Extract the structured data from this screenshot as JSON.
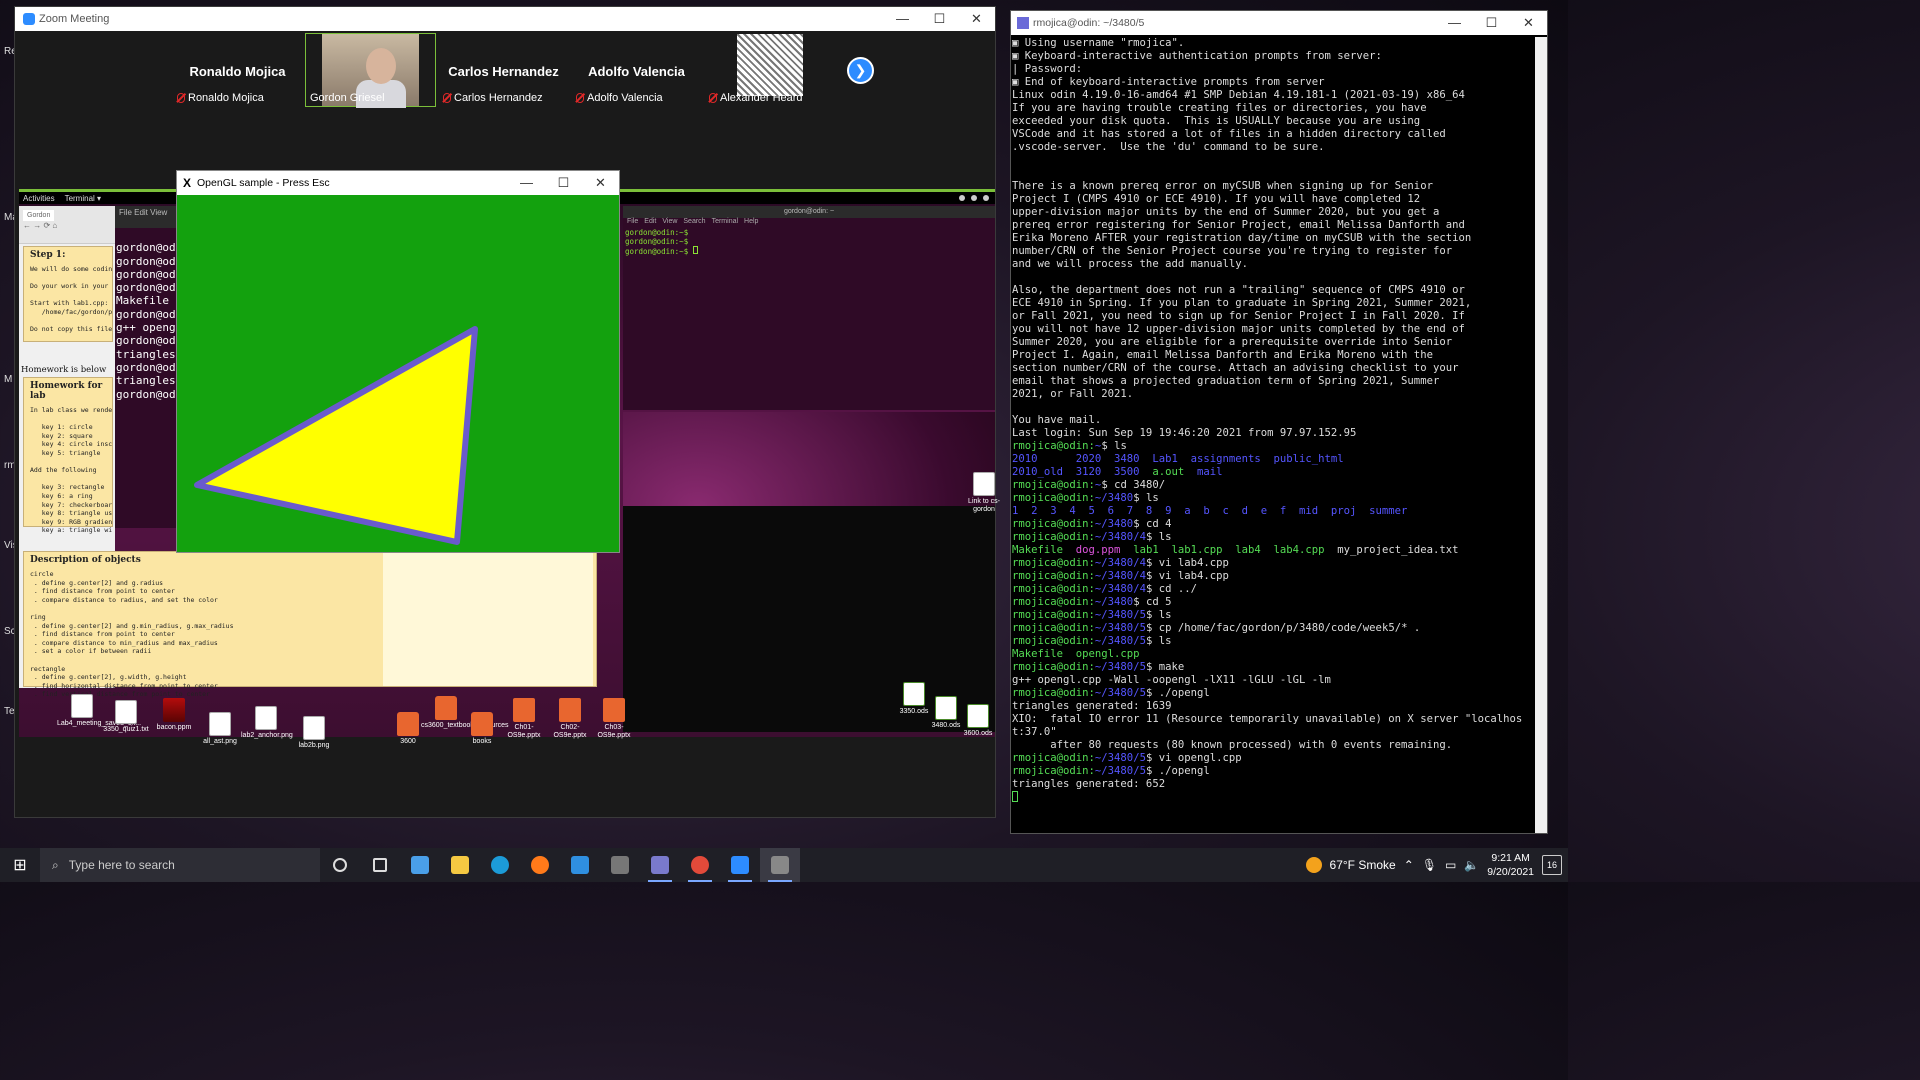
{
  "zoom": {
    "title": "Zoom Meeting",
    "participants": [
      {
        "big_name": "Ronaldo Mojica",
        "name": "Ronaldo Mojica",
        "video": false,
        "muted": true
      },
      {
        "big_name": "",
        "name": "Gordon Griesel",
        "video": true,
        "muted": false,
        "active_speaker": true
      },
      {
        "big_name": "Carlos Hernandez",
        "name": "Carlos Hernandez",
        "video": false,
        "muted": true
      },
      {
        "big_name": "Adolfo Valencia",
        "name": "Adolfo Valencia",
        "video": false,
        "muted": true
      },
      {
        "big_name": "",
        "name": "Alexander Heard",
        "video": false,
        "avatar": "manga-image",
        "muted": true
      }
    ],
    "next_icon": "arrow-right-icon"
  },
  "shared_screen": {
    "topbar": {
      "activities": "Activities",
      "app": "Terminal ▾"
    },
    "browser_tab": "Gordon",
    "step_title": "Step 1:",
    "step_text": "We will do some coding\n\nDo your work in your Od\n\nStart with lab1.cpp:\n   /home/fac/gordon/pub\n\nDo not copy this file a",
    "homework_label": "Homework is below",
    "homework_title": "Homework for lab",
    "homework_text": "In lab class we rendere\n\n   key 1: circle\n   key 2: square\n   key 4: circle inscri\n   key 5: triangle\n\nAdd the following\n\n   key 3: rectangle\n   key 6: a ring\n   key 7: checkerboard\n   key 8: triangle usin\n   key 9: RGB gradient\n   key a: triangle with",
    "desc_title": "Description of objects",
    "desc_text": "circle\n . define g.center[2] and g.radius\n . find distance from point to center\n . compare distance to radius, and set the color\n\nring\n . define g.center[2] and g.min_radius, g.max_radius\n . find distance from point to center\n . compare distance to min_radius and max_radius\n . set a color if between radii\n\nrectangle\n . define g.center[2], g.width, g.height\n . find horizontal distance from point to center\n . find vertical distance from point to center",
    "left_term_menu": "File  Edit  View",
    "left_term_text": "\ngordon@odi\ngordon@odi\ngordon@odi\ngordon@odi\nMakefile\ngordon@odi\ng++ opengl\ngordon@odi\ntriangles\ngordon@odi\ntriangles\ngordon@odi",
    "right_term_title": "gordon@odin: ~",
    "right_term_menu": [
      "File",
      "Edit",
      "View",
      "Search",
      "Terminal",
      "Help"
    ],
    "right_term_text": "gordon@odin:~$\ngordon@odin:~$\ngordon@odin:~$ ",
    "desktop_link": "Link to cs-gordon",
    "desktop_icons": [
      {
        "label": "Lab4_meeting_saved_ch...",
        "kind": "file"
      },
      {
        "label": "3350_quiz1.txt",
        "kind": "file"
      },
      {
        "label": "bacon.ppm",
        "kind": "img"
      },
      {
        "label": "all_ast.png",
        "kind": "file"
      },
      {
        "label": "lab2_anchor.png",
        "kind": "file"
      },
      {
        "label": "lab2b.png",
        "kind": "file"
      },
      {
        "label": "3600",
        "kind": "folder"
      },
      {
        "label": "cs3600_textbook_resources",
        "kind": "folder"
      },
      {
        "label": "books",
        "kind": "folder"
      },
      {
        "label": "Ch01-OS9e.pptx",
        "kind": "ppt"
      },
      {
        "label": "Ch02-OS9e.pptx",
        "kind": "ppt"
      },
      {
        "label": "Ch03-OS9e.pptx",
        "kind": "ppt"
      },
      {
        "label": "3350.ods",
        "kind": "sheet"
      },
      {
        "label": "3480.ods",
        "kind": "sheet"
      },
      {
        "label": "3600.ods",
        "kind": "sheet"
      }
    ]
  },
  "opengl": {
    "title": "OpenGL sample  -  Press Esc",
    "background_color": "#13a10e",
    "triangle_fill": "#ffff00",
    "triangle_outline": "#6a5acd"
  },
  "putty": {
    "title": "rmojica@odin: ~/3480/5",
    "lines": [
      [
        {
          "t": "▣ Using username \"rmojica\".",
          "c": "white"
        }
      ],
      [
        {
          "t": "▣ Keyboard-interactive authentication prompts from server:",
          "c": "white"
        }
      ],
      [
        {
          "t": "| Password:",
          "c": "white"
        }
      ],
      [
        {
          "t": "▣ End of keyboard-interactive prompts from server",
          "c": "white"
        }
      ],
      [
        {
          "t": "Linux odin 4.19.0-16-amd64 #1 SMP Debian 4.19.181-1 (2021-03-19) x86_64",
          "c": "white"
        }
      ],
      [
        {
          "t": "If you are having trouble creating files or directories, you have",
          "c": "white"
        }
      ],
      [
        {
          "t": "exceeded your disk quota.  This is USUALLY because you are using",
          "c": "white"
        }
      ],
      [
        {
          "t": "VSCode and it has stored a lot of files in a hidden directory called",
          "c": "white"
        }
      ],
      [
        {
          "t": ".vscode-server.  Use the 'du' command to be sure.",
          "c": "white"
        }
      ],
      [
        {
          "t": "",
          "c": "white"
        }
      ],
      [
        {
          "t": "",
          "c": "white"
        }
      ],
      [
        {
          "t": "There is a known prereq error on myCSUB when signing up for Senior",
          "c": "white"
        }
      ],
      [
        {
          "t": "Project I (CMPS 4910 or ECE 4910). If you will have completed 12",
          "c": "white"
        }
      ],
      [
        {
          "t": "upper-division major units by the end of Summer 2020, but you get a",
          "c": "white"
        }
      ],
      [
        {
          "t": "prereq error registering for Senior Project, email Melissa Danforth and",
          "c": "white"
        }
      ],
      [
        {
          "t": "Erika Moreno AFTER your registration day/time on myCSUB with the section",
          "c": "white"
        }
      ],
      [
        {
          "t": "number/CRN of the Senior Project course you're trying to register for",
          "c": "white"
        }
      ],
      [
        {
          "t": "and we will process the add manually.",
          "c": "white"
        }
      ],
      [
        {
          "t": "",
          "c": "white"
        }
      ],
      [
        {
          "t": "Also, the department does not run a \"trailing\" sequence of CMPS 4910 or",
          "c": "white"
        }
      ],
      [
        {
          "t": "ECE 4910 in Spring. If you plan to graduate in Spring 2021, Summer 2021,",
          "c": "white"
        }
      ],
      [
        {
          "t": "or Fall 2021, you need to sign up for Senior Project I in Fall 2020. If",
          "c": "white"
        }
      ],
      [
        {
          "t": "you will not have 12 upper-division major units completed by the end of",
          "c": "white"
        }
      ],
      [
        {
          "t": "Summer 2020, you are eligible for a prerequisite override into Senior",
          "c": "white"
        }
      ],
      [
        {
          "t": "Project I. Again, email Melissa Danforth and Erika Moreno with the",
          "c": "white"
        }
      ],
      [
        {
          "t": "section number/CRN of the course. Attach an advising checklist to your",
          "c": "white"
        }
      ],
      [
        {
          "t": "email that shows a projected graduation term of Spring 2021, Summer",
          "c": "white"
        }
      ],
      [
        {
          "t": "2021, or Fall 2021.",
          "c": "white"
        }
      ],
      [
        {
          "t": "",
          "c": "white"
        }
      ],
      [
        {
          "t": "You have mail.",
          "c": "white"
        }
      ],
      [
        {
          "t": "Last login: Sun Sep 19 19:46:20 2021 from 97.97.152.95",
          "c": "white"
        }
      ],
      [
        {
          "t": "rmojica@odin:",
          "c": "green"
        },
        {
          "t": "~",
          "c": "blue"
        },
        {
          "t": "$ ls",
          "c": "white"
        }
      ],
      [
        {
          "t": "2010      2020  3480  Lab1  assignments  public_html",
          "c": "blue"
        }
      ],
      [
        {
          "t": "2010_old  3120  3500  ",
          "c": "blue"
        },
        {
          "t": "a.out",
          "c": "green"
        },
        {
          "t": "  mail",
          "c": "blue"
        }
      ],
      [
        {
          "t": "rmojica@odin:",
          "c": "green"
        },
        {
          "t": "~",
          "c": "blue"
        },
        {
          "t": "$ cd 3480/",
          "c": "white"
        }
      ],
      [
        {
          "t": "rmojica@odin:",
          "c": "green"
        },
        {
          "t": "~/3480",
          "c": "blue"
        },
        {
          "t": "$ ls",
          "c": "white"
        }
      ],
      [
        {
          "t": "1  2  3  4  5  6  7  8  9  a  b  c  d  e  f  mid  proj  summer",
          "c": "blue"
        }
      ],
      [
        {
          "t": "rmojica@odin:",
          "c": "green"
        },
        {
          "t": "~/3480",
          "c": "blue"
        },
        {
          "t": "$ cd 4",
          "c": "white"
        }
      ],
      [
        {
          "t": "rmojica@odin:",
          "c": "green"
        },
        {
          "t": "~/3480/4",
          "c": "blue"
        },
        {
          "t": "$ ls",
          "c": "white"
        }
      ],
      [
        {
          "t": "Makefile  ",
          "c": "green"
        },
        {
          "t": "dog.ppm",
          "c": "mag"
        },
        {
          "t": "  lab1  lab1.cpp  lab4  lab4.cpp  ",
          "c": "green"
        },
        {
          "t": "my_project_idea.txt",
          "c": "white"
        }
      ],
      [
        {
          "t": "rmojica@odin:",
          "c": "green"
        },
        {
          "t": "~/3480/4",
          "c": "blue"
        },
        {
          "t": "$ vi lab4.cpp",
          "c": "white"
        }
      ],
      [
        {
          "t": "rmojica@odin:",
          "c": "green"
        },
        {
          "t": "~/3480/4",
          "c": "blue"
        },
        {
          "t": "$ vi lab4.cpp",
          "c": "white"
        }
      ],
      [
        {
          "t": "rmojica@odin:",
          "c": "green"
        },
        {
          "t": "~/3480/4",
          "c": "blue"
        },
        {
          "t": "$ cd ../",
          "c": "white"
        }
      ],
      [
        {
          "t": "rmojica@odin:",
          "c": "green"
        },
        {
          "t": "~/3480",
          "c": "blue"
        },
        {
          "t": "$ cd 5",
          "c": "white"
        }
      ],
      [
        {
          "t": "rmojica@odin:",
          "c": "green"
        },
        {
          "t": "~/3480/5",
          "c": "blue"
        },
        {
          "t": "$ ls",
          "c": "white"
        }
      ],
      [
        {
          "t": "rmojica@odin:",
          "c": "green"
        },
        {
          "t": "~/3480/5",
          "c": "blue"
        },
        {
          "t": "$ cp /home/fac/gordon/p/3480/code/week5/* .",
          "c": "white"
        }
      ],
      [
        {
          "t": "rmojica@odin:",
          "c": "green"
        },
        {
          "t": "~/3480/5",
          "c": "blue"
        },
        {
          "t": "$ ls",
          "c": "white"
        }
      ],
      [
        {
          "t": "Makefile  opengl.cpp",
          "c": "green"
        }
      ],
      [
        {
          "t": "rmojica@odin:",
          "c": "green"
        },
        {
          "t": "~/3480/5",
          "c": "blue"
        },
        {
          "t": "$ make",
          "c": "white"
        }
      ],
      [
        {
          "t": "g++ opengl.cpp -Wall -oopengl -lX11 -lGLU -lGL -lm",
          "c": "white"
        }
      ],
      [
        {
          "t": "rmojica@odin:",
          "c": "green"
        },
        {
          "t": "~/3480/5",
          "c": "blue"
        },
        {
          "t": "$ ./opengl",
          "c": "white"
        }
      ],
      [
        {
          "t": "triangles generated: 1639",
          "c": "white"
        }
      ],
      [
        {
          "t": "XIO:  fatal IO error 11 (Resource temporarily unavailable) on X server \"localhos",
          "c": "white"
        }
      ],
      [
        {
          "t": "t:37.0\"",
          "c": "white"
        }
      ],
      [
        {
          "t": "      after 80 requests (80 known processed) with 0 events remaining.",
          "c": "white"
        }
      ],
      [
        {
          "t": "rmojica@odin:",
          "c": "green"
        },
        {
          "t": "~/3480/5",
          "c": "blue"
        },
        {
          "t": "$ vi opengl.cpp",
          "c": "white"
        }
      ],
      [
        {
          "t": "rmojica@odin:",
          "c": "green"
        },
        {
          "t": "~/3480/5",
          "c": "blue"
        },
        {
          "t": "$ ./opengl",
          "c": "white"
        }
      ],
      [
        {
          "t": "triangles generated: 652",
          "c": "white"
        }
      ]
    ]
  },
  "desktop_strip": [
    "Re",
    "Ma",
    "M",
    "rm",
    "Vis",
    "Sc",
    "Te"
  ],
  "taskbar": {
    "search_placeholder": "Type here to search",
    "apps": [
      "cortana-icon",
      "task-view-icon",
      "photos-icon",
      "file-explorer-icon",
      "edge-icon",
      "firefox-icon",
      "vscode-icon",
      "terminal-icon",
      "putty-icon",
      "chrome-icon",
      "zoom-icon",
      "xming-icon"
    ],
    "weather": "67°F  Smoke",
    "time": "9:21 AM",
    "date": "9/20/2021",
    "notifications": "16"
  }
}
